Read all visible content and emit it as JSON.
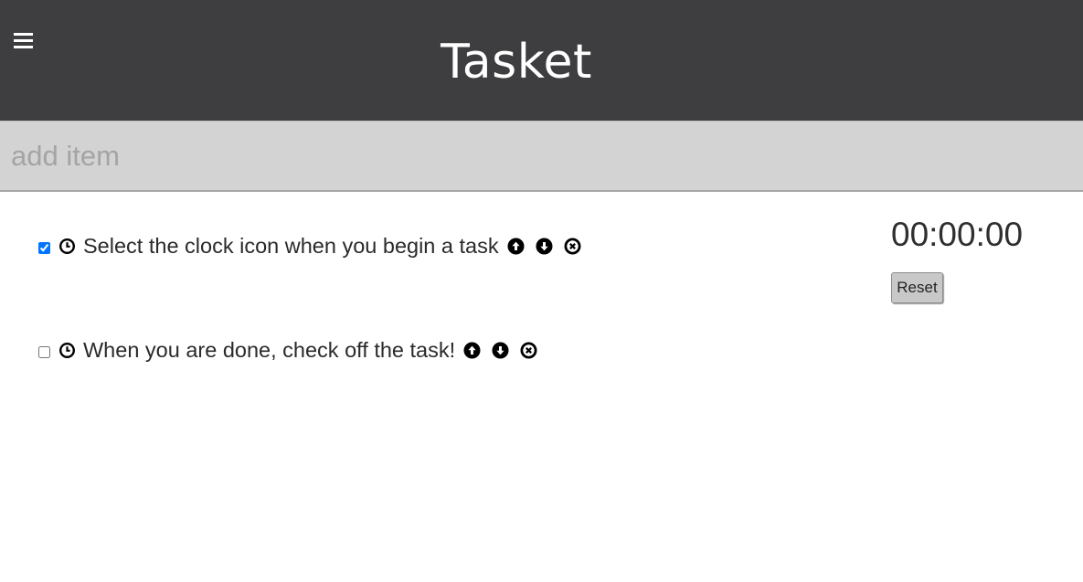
{
  "header": {
    "title": "Tasket",
    "menu_icon": "hamburger-menu-icon",
    "background": "#3e3e40"
  },
  "add_item": {
    "placeholder": "add item",
    "value": ""
  },
  "tasks": [
    {
      "text": "Select the clock icon when you begin a task",
      "checked": true,
      "icons": [
        "clock-icon",
        "move-up-icon",
        "move-down-icon",
        "delete-icon"
      ]
    },
    {
      "text": "When you are done, check off the task!",
      "checked": false,
      "icons": [
        "clock-icon",
        "move-up-icon",
        "move-down-icon",
        "delete-icon"
      ]
    }
  ],
  "timer": {
    "display": "00:00:00",
    "reset_label": "Reset"
  }
}
